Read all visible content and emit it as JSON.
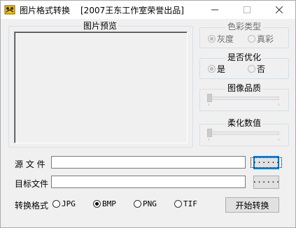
{
  "window": {
    "title": "图片格式转换",
    "subtitle": "[2007王东工作室荣誉出品]",
    "minimize_icon": "minimize-icon",
    "maximize_icon": "maximize-icon",
    "close_icon": "close-icon"
  },
  "preview": {
    "title": "图片预览"
  },
  "color_type": {
    "title": "色彩类型",
    "options": [
      {
        "label": "灰度",
        "checked": true
      },
      {
        "label": "真彩",
        "checked": false
      }
    ]
  },
  "optimize": {
    "title": "是否优化",
    "options": [
      {
        "label": "是",
        "checked": true
      },
      {
        "label": "否",
        "checked": false
      }
    ]
  },
  "quality": {
    "title": "图像品质",
    "level": 0
  },
  "soften": {
    "title": "柔化数值",
    "level": 0
  },
  "source_file": {
    "label": "源 文 件",
    "value": "",
    "browse_label": "······"
  },
  "target_file": {
    "label": "目标文件",
    "value": "",
    "browse_label": "······"
  },
  "format": {
    "label": "转换格式",
    "options": [
      {
        "label": "JPG",
        "checked": false
      },
      {
        "label": "BMP",
        "checked": true
      },
      {
        "label": "PNG",
        "checked": false
      },
      {
        "label": "TIF",
        "checked": false
      }
    ]
  },
  "convert_button": {
    "label": "开始转换"
  }
}
